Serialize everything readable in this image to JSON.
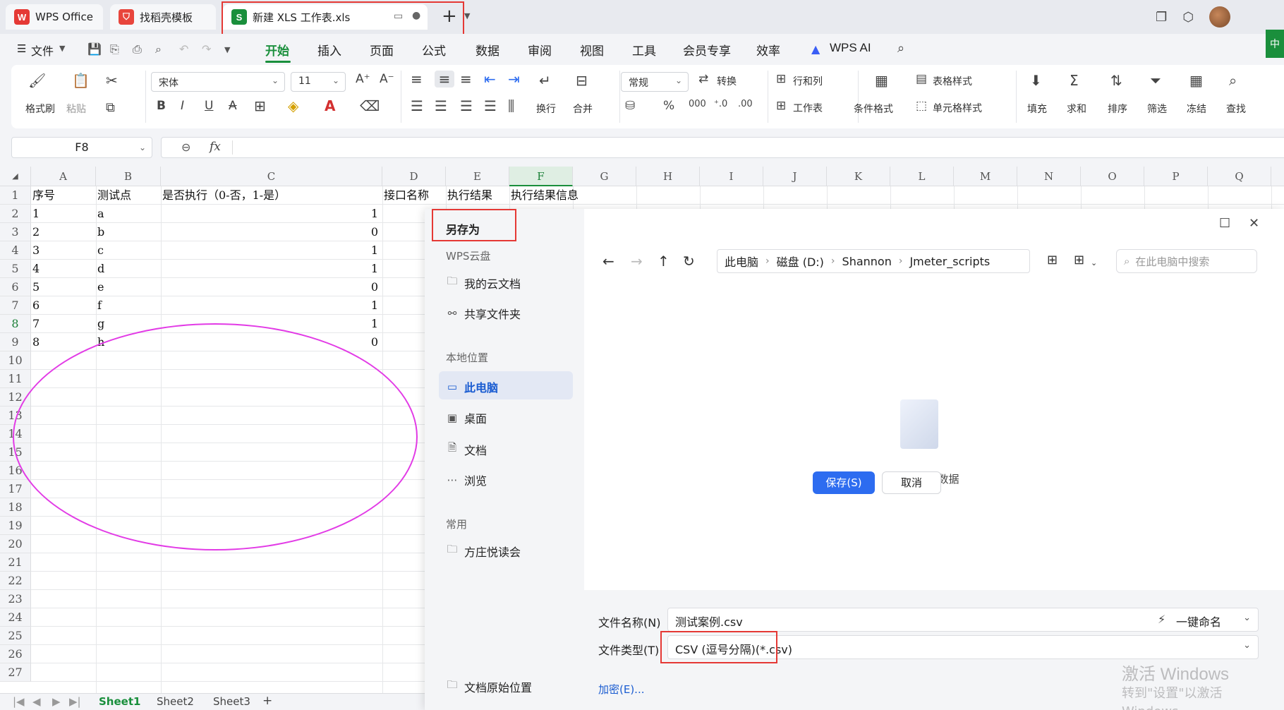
{
  "tabs": {
    "wps_logo": "W",
    "wps": "WPS Office",
    "template_logo": "⛉",
    "template": "找稻壳模板",
    "doc_logo": "S",
    "doc": "新建 XLS 工作表.xls",
    "add": "+"
  },
  "menu": {
    "file": "文件",
    "items": [
      "开始",
      "插入",
      "页面",
      "公式",
      "数据",
      "审阅",
      "视图",
      "工具",
      "会员专享",
      "效率"
    ],
    "wps_ai": "WPS AI",
    "lang_badge": "中"
  },
  "ribbon": {
    "format_painter": "格式刷",
    "paste": "粘贴",
    "font_name": "宋体",
    "font_size": "11",
    "wrap": "换行",
    "merge": "合并",
    "number_format": "常规",
    "convert": "转换",
    "row_col": "行和列",
    "worksheet": "工作表",
    "cond_format": "条件格式",
    "table_style": "表格样式",
    "cell_style": "单元格样式",
    "fill": "填充",
    "sum": "求和",
    "sort": "排序",
    "filter": "筛选",
    "freeze": "冻结",
    "find": "查找"
  },
  "formula_bar": {
    "cell_ref": "F8",
    "fx": "fx"
  },
  "sheet": {
    "columns": [
      "A",
      "B",
      "C",
      "D",
      "E",
      "F",
      "G",
      "H",
      "I",
      "J",
      "K",
      "L",
      "M",
      "N",
      "O",
      "P",
      "Q"
    ],
    "selected_column": "F",
    "selected_row": "8",
    "row_numbers": [
      "1",
      "2",
      "3",
      "4",
      "5",
      "6",
      "7",
      "8",
      "9",
      "10",
      "11",
      "12",
      "13",
      "14",
      "15",
      "16",
      "17",
      "18",
      "19",
      "20",
      "21",
      "22",
      "23",
      "24",
      "25",
      "26",
      "27"
    ],
    "header": [
      "序号",
      "测试点",
      "是否执行（0-否，1-是）",
      "接口名称",
      "执行结果",
      "执行结果信息"
    ],
    "rows": [
      [
        "1",
        "a",
        "1"
      ],
      [
        "2",
        "b",
        "0"
      ],
      [
        "3",
        "c",
        "1"
      ],
      [
        "4",
        "d",
        "1"
      ],
      [
        "5",
        "e",
        "0"
      ],
      [
        "6",
        "f",
        "1"
      ],
      [
        "7",
        "g",
        "1"
      ],
      [
        "8",
        "h",
        "0"
      ]
    ],
    "sheet_tabs": [
      "Sheet1",
      "Sheet2",
      "Sheet3"
    ],
    "add_sheet": "+"
  },
  "dialog": {
    "title": "另存为",
    "cloud_section": "WPS云盘",
    "my_cloud": "我的云文档",
    "shared_folder": "共享文件夹",
    "local_section": "本地位置",
    "this_pc": "此电脑",
    "desktop": "桌面",
    "documents": "文档",
    "browse": "浏览",
    "common_section": "常用",
    "reading_club": "方庄悦读会",
    "original_location": "文档原始位置",
    "breadcrumb": [
      "此电脑",
      "磁盘 (D:)",
      "Shannon",
      "Jmeter_scripts"
    ],
    "search_placeholder": "在此电脑中搜索",
    "empty_text": "当前位置无数据",
    "filename_label": "文件名称(N)",
    "filename_value": "测试案例.csv",
    "rename_button": "一键命名",
    "filetype_label": "文件类型(T)",
    "filetype_value": "CSV (逗号分隔)(*.csv)",
    "encrypt": "加密(E)...",
    "save": "保存(S)",
    "cancel": "取消"
  },
  "watermark": {
    "line1": "激活 Windows",
    "line2": "转到\"设置\"以激活 Windows。"
  },
  "colors": {
    "accent_green": "#1a8f3c",
    "annotation_red": "#e53935",
    "annotation_magenta": "#e23be6",
    "save_blue": "#2d6cf0"
  }
}
